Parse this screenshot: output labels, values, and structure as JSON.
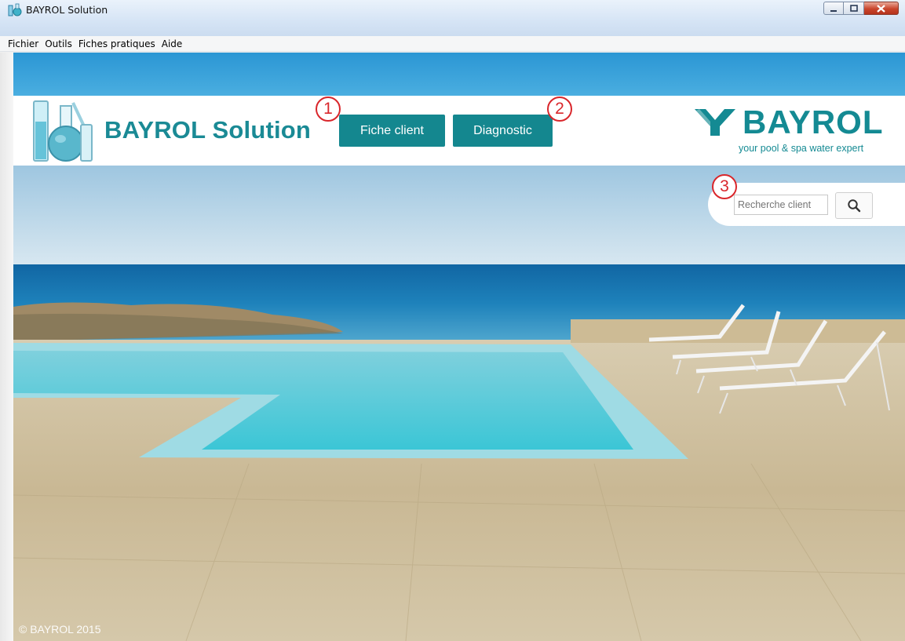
{
  "window": {
    "title": "BAYROL Solution",
    "controls": [
      "minimize",
      "maximize",
      "close"
    ]
  },
  "menubar": {
    "items": [
      "Fichier",
      "Outils",
      "Fiches pratiques",
      "Aide"
    ]
  },
  "header": {
    "brand_title": "BAYROL Solution",
    "nav": [
      {
        "label": "Fiche client"
      },
      {
        "label": "Diagnostic"
      }
    ],
    "logo_word": "BAYROL",
    "logo_tagline": "your pool & spa water expert"
  },
  "markers": [
    "1",
    "2",
    "3"
  ],
  "search": {
    "placeholder": "Recherche client",
    "icon": "search-icon"
  },
  "footer": {
    "copyright": "© BAYROL 2015"
  },
  "colors": {
    "accent": "#14878f",
    "marker": "#d9262b",
    "title_bar": "#d5e4f5"
  }
}
